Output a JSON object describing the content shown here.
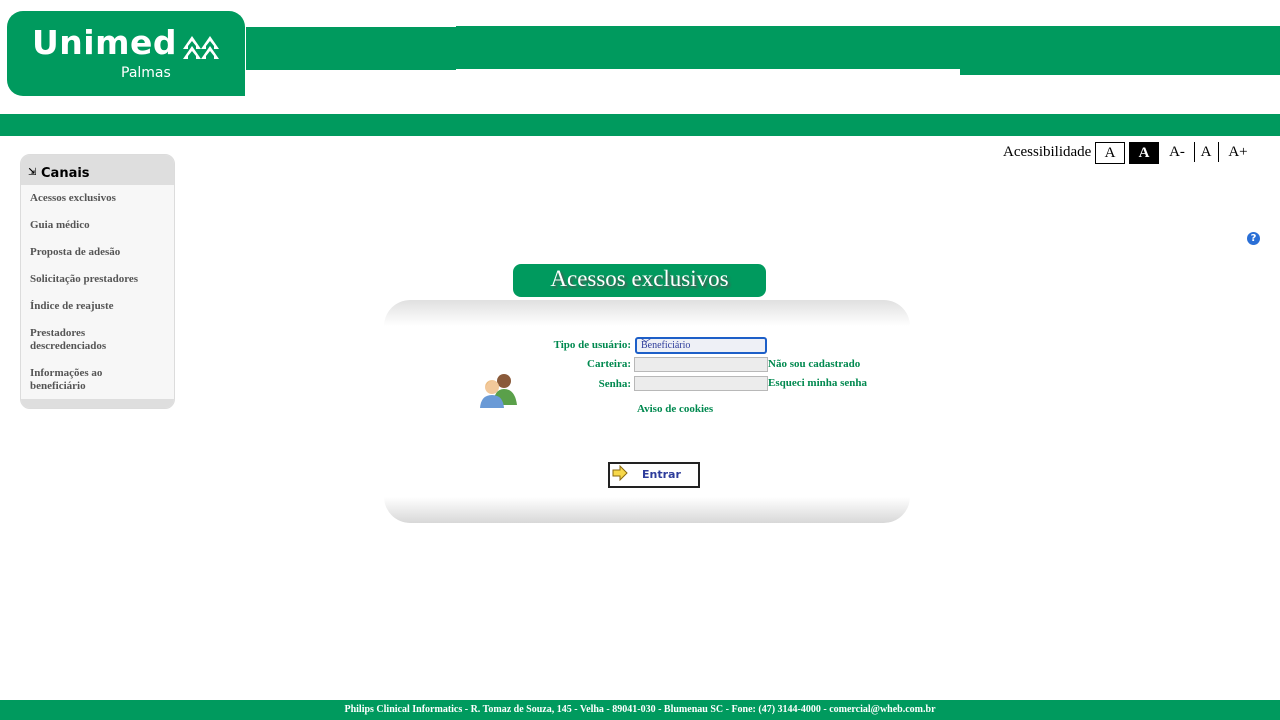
{
  "header": {
    "logo_name": "Unimed",
    "logo_city": "Palmas",
    "help_icon": "question-circle-icon"
  },
  "accessibility": {
    "label": "Acessibilidade",
    "contrast_normal": "A",
    "contrast_high": "A",
    "font_smaller": "A-",
    "font_normal": "A",
    "font_larger": "A+"
  },
  "sidebar": {
    "title": "Canais",
    "items": [
      {
        "label": "Acessos exclusivos"
      },
      {
        "label": "Guia médico"
      },
      {
        "label": "Proposta de adesão"
      },
      {
        "label": "Solicitação prestadores"
      },
      {
        "label": "Índice de reajuste"
      },
      {
        "label": "Prestadores descredenciados"
      },
      {
        "label": "Informações ao beneficiário"
      }
    ]
  },
  "login": {
    "title": "Acessos exclusivos",
    "user_type_label": "Tipo de usuário:",
    "user_type_value": "Beneficiário",
    "card_label": "Carteira:",
    "card_value": "",
    "password_label": "Senha:",
    "password_value": "",
    "not_registered_link": "Não sou cadastrado",
    "forgot_password_link": "Esqueci minha senha",
    "cookies_link": "Aviso de cookies",
    "submit_label": "Entrar"
  },
  "footer": {
    "text": "Philips Clinical Informatics - R. Tomaz de Souza, 145 - Velha - 89041-030 - Blumenau SC - Fone: (47) 3144-4000 - comercial@wheb.com.br"
  },
  "colors": {
    "brand_green": "#009a5e",
    "link_green": "#00894f",
    "select_border": "#1d5fc8"
  }
}
